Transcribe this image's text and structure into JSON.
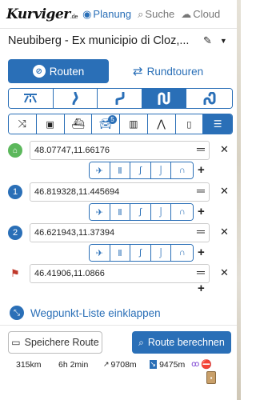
{
  "nav": {
    "logo": "Kurviger",
    "logo_suffix": ".de",
    "items": [
      {
        "label": "Planung",
        "icon": "compass-icon",
        "active": true
      },
      {
        "label": "Suche",
        "icon": "search-icon",
        "active": false
      },
      {
        "label": "Cloud",
        "icon": "cloud-icon",
        "active": false
      }
    ]
  },
  "route": {
    "title": "Neubiberg - Ex municipio di Cloz,..."
  },
  "mode": {
    "route_label": "Routen",
    "tour_label": "Rundtouren"
  },
  "curviness": {
    "options": [
      "highway",
      "slight-curve",
      "curvy",
      "very-curvy",
      "extremely-curvy"
    ],
    "selected_index": 3
  },
  "avoid": {
    "options": [
      "shuffle",
      "toll",
      "ferry",
      "car",
      "tunnel",
      "narrow-road",
      "traffic-light",
      "settings"
    ],
    "badge": "5",
    "selected_index": 7
  },
  "waypoints": [
    {
      "marker": "home",
      "label": "",
      "value": "48.07747,11.66176"
    },
    {
      "marker": "number",
      "label": "1",
      "value": "46.819328,11.445694"
    },
    {
      "marker": "number",
      "label": "2",
      "value": "46.621943,11.37394"
    },
    {
      "marker": "flag",
      "label": "",
      "value": "46.41906,11.0866"
    }
  ],
  "collapse_label": "Wegpunkt-Liste einklappen",
  "buttons": {
    "save": "Speichere Route",
    "calculate": "Route berechnen"
  },
  "stats": {
    "distance": "315km",
    "duration": "6h 2min",
    "ascent": "9708m",
    "descent": "9475m"
  },
  "colors": {
    "accent": "#2a6fb7",
    "home": "#5cb85c",
    "flag": "#c0392b"
  }
}
